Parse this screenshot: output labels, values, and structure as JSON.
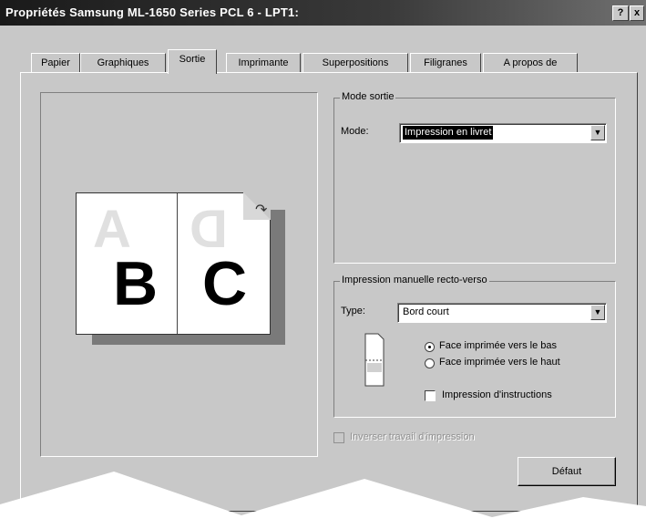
{
  "window": {
    "title": "Propriétés Samsung ML-1650 Series PCL 6 - LPT1:",
    "help_button": "?",
    "close_button": "x"
  },
  "tabs": [
    {
      "label": "Papier"
    },
    {
      "label": "Graphiques"
    },
    {
      "label": "Sortie"
    },
    {
      "label": "Imprimante"
    },
    {
      "label": "Superpositions"
    },
    {
      "label": "Filigranes"
    },
    {
      "label": "A propos de"
    }
  ],
  "active_tab": "Sortie",
  "preview": {
    "ghost_left": "A",
    "ghost_right": "D",
    "page_left": "B",
    "page_right": "C"
  },
  "mode_group": {
    "legend": "Mode sortie",
    "mode_label": "Mode:",
    "mode_value": "Impression en livret"
  },
  "duplex_group": {
    "legend": "Impression manuelle recto-verso",
    "type_label": "Type:",
    "type_value": "Bord court",
    "radio_bottom": "Face imprimée vers le bas",
    "radio_top": "Face imprimée vers le haut",
    "instructions": "Impression d'instructions",
    "selected": "bottom"
  },
  "reverse_job": "Inverser travail d'impression",
  "default_button": "Défaut",
  "colors": {
    "dialog": "#c8c8c8",
    "titlebar": "#1a1a1a"
  }
}
